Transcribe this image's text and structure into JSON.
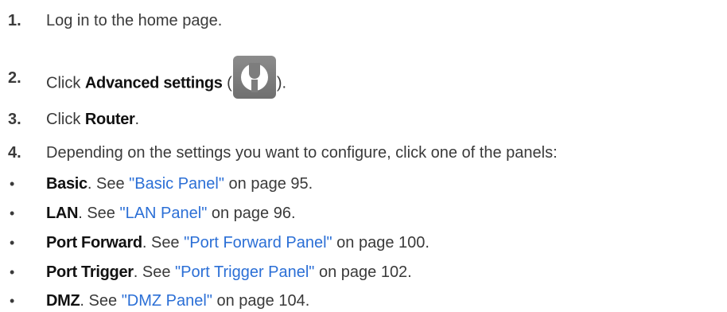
{
  "steps": [
    {
      "num": "1.",
      "text": "Log in to the home page."
    },
    {
      "num": "2.",
      "pre": "Click ",
      "ui": "Advanced settings",
      "open": " (",
      "close": ").",
      "icon": "wrench-icon"
    },
    {
      "num": "3.",
      "pre": "Click ",
      "ui": "Router",
      "post": "."
    },
    {
      "num": "4.",
      "text": "Depending on the settings you want to configure, click one of the panels:"
    }
  ],
  "bullets": [
    {
      "symbol": "•",
      "ui": "Basic",
      "mid": ". See ",
      "link": "\"Basic Panel\"",
      "post": " on page 95."
    },
    {
      "symbol": "•",
      "ui": "LAN",
      "mid": ". See ",
      "link": "\"LAN Panel\"",
      "post": " on page 96."
    },
    {
      "symbol": "•",
      "ui": "Port Forward",
      "mid": ". See ",
      "link": "\"Port Forward Panel\"",
      "post": " on page 100."
    },
    {
      "symbol": "•",
      "ui": "Port Trigger",
      "mid": ". See ",
      "link": "\"Port Trigger Panel\"",
      "post": " on page 102."
    },
    {
      "symbol": "•",
      "ui": "DMZ",
      "mid": ". See ",
      "link": "\"DMZ Panel\"",
      "post": " on page 104."
    }
  ],
  "colors": {
    "text": "#3a3a3a",
    "link": "#2b6fd6",
    "icon_bg": "#7d7d7d"
  }
}
